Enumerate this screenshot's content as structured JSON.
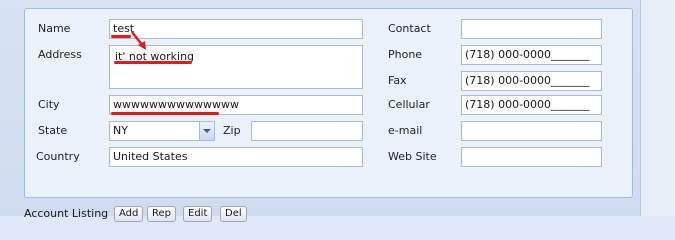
{
  "form": {
    "name": {
      "label": "Name",
      "value": "test"
    },
    "address": {
      "label": "Address",
      "value": "it' not working"
    },
    "city": {
      "label": "City",
      "value": "wwwwwwwwwwwwww"
    },
    "state": {
      "label": "State",
      "value": "NY"
    },
    "zip": {
      "label": "Zip",
      "value": ""
    },
    "country": {
      "label": "Country",
      "value": "United States"
    },
    "contact": {
      "label": "Contact",
      "value": ""
    },
    "phone": {
      "label": "Phone",
      "value": "(718) 000-0000_______"
    },
    "fax": {
      "label": "Fax",
      "value": "(718) 000-0000_______"
    },
    "cellular": {
      "label": "Cellular",
      "value": "(718) 000-0000_______"
    },
    "email": {
      "label": "e-mail",
      "value": ""
    },
    "website": {
      "label": "Web Site",
      "value": ""
    }
  },
  "toolbar": {
    "label": "Account Listing",
    "add": "Add",
    "rep": "Rep",
    "edit": "Edit",
    "del": "Del"
  },
  "annotation_color": "#e11b1b"
}
